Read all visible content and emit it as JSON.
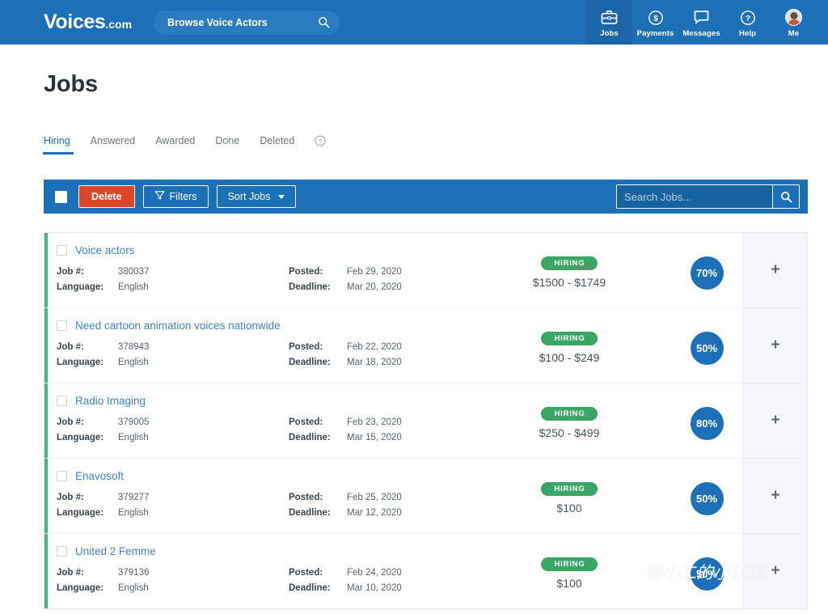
{
  "header": {
    "logo_main": "Voices",
    "logo_suffix": ".com",
    "browse_label": "Browse Voice Actors",
    "browse_icon": "search-icon",
    "brand_blue": "#1c70b8",
    "nav": [
      {
        "label": "Jobs",
        "icon": "briefcase-icon",
        "active": true
      },
      {
        "label": "Payments",
        "icon": "dollar-circle-icon",
        "active": false
      },
      {
        "label": "Messages",
        "icon": "chat-bubble-icon",
        "active": false
      },
      {
        "label": "Help",
        "icon": "question-circle-icon",
        "active": false
      },
      {
        "label": "Me",
        "icon": "avatar-icon",
        "active": false
      }
    ]
  },
  "page": {
    "title": "Jobs"
  },
  "tabs": {
    "items": [
      {
        "label": "Hiring",
        "active": true
      },
      {
        "label": "Answered",
        "active": false
      },
      {
        "label": "Awarded",
        "active": false
      },
      {
        "label": "Done",
        "active": false
      },
      {
        "label": "Deleted",
        "active": false
      }
    ],
    "help_icon": "question-circle-icon"
  },
  "toolbar": {
    "select_all_checkbox": "unchecked",
    "delete_label": "Delete",
    "delete_color": "#dd4527",
    "filters_label": "Filters",
    "filters_icon": "funnel-icon",
    "sort_label": "Sort Jobs",
    "sort_icon": "chevron-down-icon",
    "search_value": "",
    "search_placeholder": "Search Jobs...",
    "search_icon": "search-icon"
  },
  "job_list": {
    "labels": {
      "job_number": "Job #:",
      "language": "Language:",
      "posted": "Posted:",
      "deadline": "Deadline:"
    },
    "expand_icon": "plus-icon",
    "accent_color": "#52b07c",
    "badge_color": "#39a763",
    "rows": [
      {
        "title": "Voice actors",
        "job_number": "380037",
        "language": "English",
        "posted": "Feb 29, 2020",
        "deadline": "Mar 20, 2020",
        "status": "HIRING",
        "price": "$1500 - $1749",
        "percent": "70%",
        "expand": "+"
      },
      {
        "title": "Need cartoon animation voices nationwide",
        "job_number": "378943",
        "language": "English",
        "posted": "Feb 22, 2020",
        "deadline": "Mar 18, 2020",
        "status": "HIRING",
        "price": "$100 - $249",
        "percent": "50%",
        "expand": "+"
      },
      {
        "title": "Radio Imaging",
        "job_number": "379005",
        "language": "English",
        "posted": "Feb 23, 2020",
        "deadline": "Mar 15, 2020",
        "status": "HIRING",
        "price": "$250 - $499",
        "percent": "80%",
        "expand": "+"
      },
      {
        "title": "Enavosoft",
        "job_number": "379277",
        "language": "English",
        "posted": "Feb 25, 2020",
        "deadline": "Mar 12, 2020",
        "status": "HIRING",
        "price": "$100",
        "percent": "50%",
        "expand": "+"
      },
      {
        "title": "United 2 Femme",
        "job_number": "379136",
        "language": "English",
        "posted": "Feb 24, 2020",
        "deadline": "Mar 10, 2020",
        "status": "HIRING",
        "price": "$100",
        "percent": "50%",
        "expand": "+"
      }
    ]
  },
  "watermark": {
    "text": "杨小二的小江湖",
    "logo_icon": "wechat-icon"
  }
}
